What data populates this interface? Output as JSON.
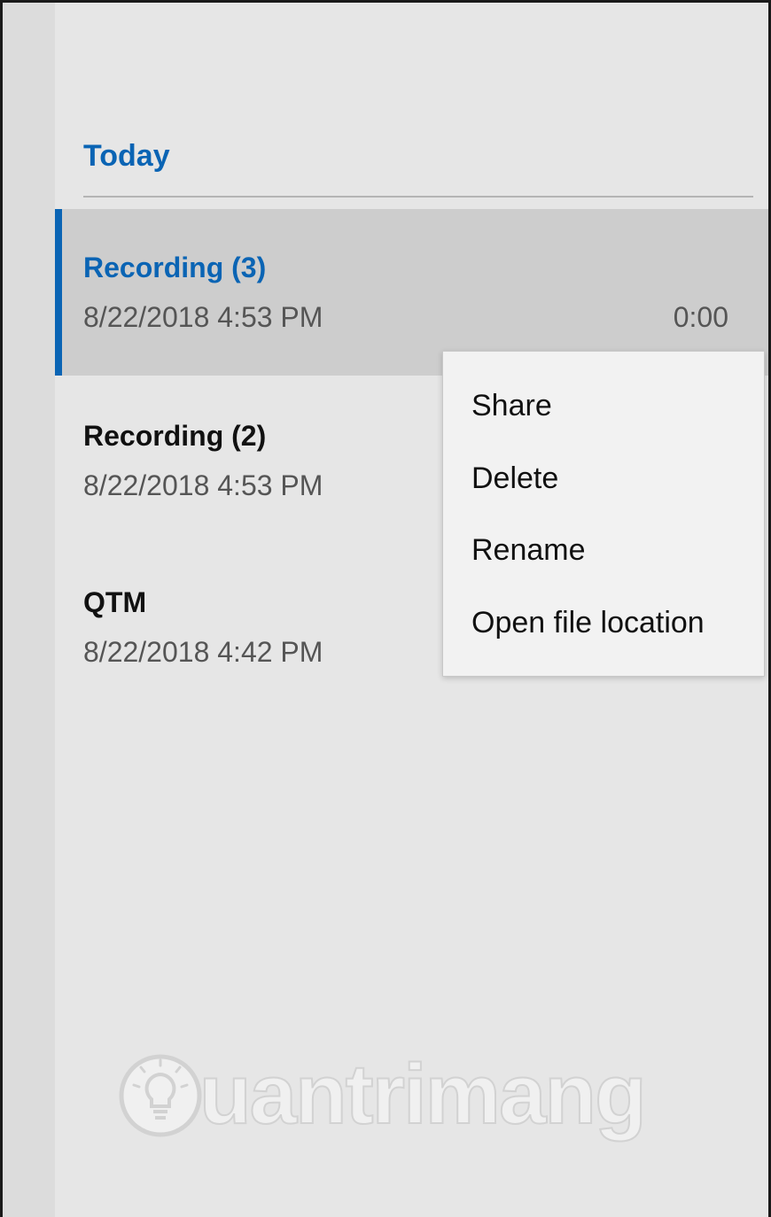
{
  "recordings": {
    "section_header": "Today",
    "items": [
      {
        "title": "Recording (3)",
        "date": "8/22/2018 4:53 PM",
        "duration": "0:00",
        "selected": true
      },
      {
        "title": "Recording (2)",
        "date": "8/22/2018 4:53 PM",
        "duration": "",
        "selected": false
      },
      {
        "title": "QTM",
        "date": "8/22/2018 4:42 PM",
        "duration": "",
        "selected": false
      }
    ]
  },
  "context_menu": {
    "items": [
      {
        "label": "Share"
      },
      {
        "label": "Delete"
      },
      {
        "label": "Rename"
      },
      {
        "label": "Open file location"
      }
    ]
  },
  "watermark": {
    "text": "uantrimang",
    "icon": "lightbulb-icon"
  },
  "colors": {
    "accent": "#0a64b4",
    "selected_background": "#cdcdcd",
    "pane_background": "#e6e6e6",
    "menu_background": "#f2f2f2"
  }
}
